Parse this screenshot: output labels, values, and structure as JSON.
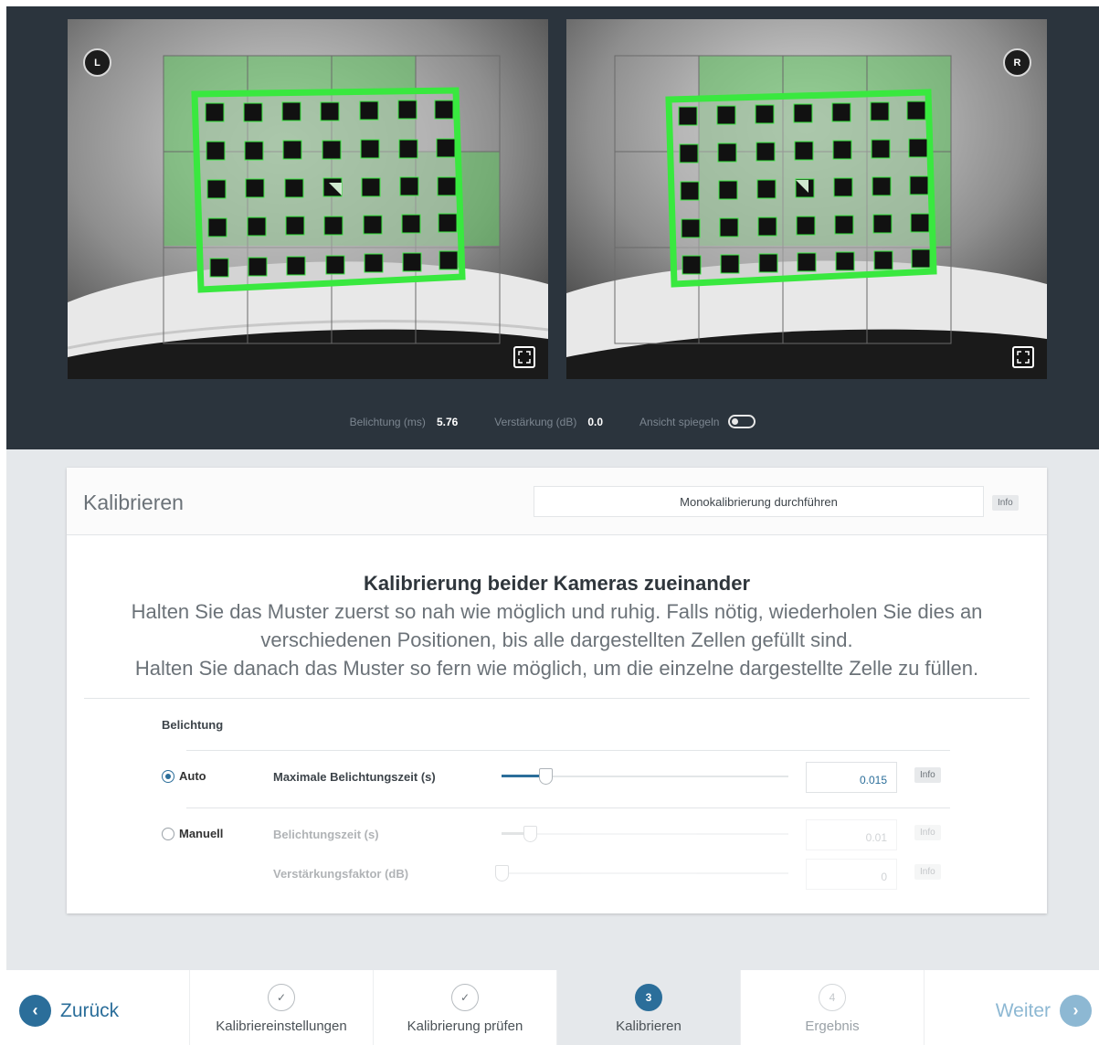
{
  "cameras": {
    "left": {
      "badge": "L"
    },
    "right": {
      "badge": "R"
    }
  },
  "camera_stats": {
    "exposure_label": "Belichtung (ms)",
    "exposure_value": "5.76",
    "gain_label": "Verstärkung (dB)",
    "gain_value": "0.0",
    "mirror_label": "Ansicht spiegeln",
    "mirror_on": false
  },
  "card": {
    "title": "Kalibrieren",
    "mono_button": "Monokalibrierung durchführen",
    "info": "Info"
  },
  "instructions": {
    "heading": "Kalibrierung beider Kameras zueinander",
    "line1": "Halten Sie das Muster zuerst so nah wie möglich und ruhig. Falls nötig, wiederholen Sie dies an",
    "line2": "verschiedenen Positionen, bis alle dargestellten Zellen gefüllt sind.",
    "line3": "Halten Sie danach das Muster so fern wie möglich, um die einzelne dargestellte Zelle zu füllen."
  },
  "exposure": {
    "heading": "Belichtung",
    "auto": {
      "label": "Auto",
      "selected": true,
      "field": "Maximale Belichtungszeit (s)",
      "value": "0.015",
      "slider_fraction": 0.15
    },
    "manual": {
      "label": "Manuell",
      "selected": false,
      "fields": [
        {
          "label": "Belichtungszeit (s)",
          "value": "0.01",
          "slider_fraction": 0.1
        },
        {
          "label": "Verstärkungsfaktor (dB)",
          "value": "0",
          "slider_fraction": 0.0
        }
      ]
    }
  },
  "footer": {
    "back": "Zurück",
    "next": "Weiter",
    "steps": [
      {
        "label": "Kalibriereinstellungen",
        "state": "done"
      },
      {
        "label": "Kalibrierung prüfen",
        "state": "done"
      },
      {
        "number": "3",
        "label": "Kalibrieren",
        "state": "active"
      },
      {
        "number": "4",
        "label": "Ergebnis",
        "state": "pending"
      }
    ]
  },
  "colors": {
    "accent": "#2b6e9a",
    "pattern_outline": "#39e83f",
    "header_bg": "#2b343d"
  }
}
